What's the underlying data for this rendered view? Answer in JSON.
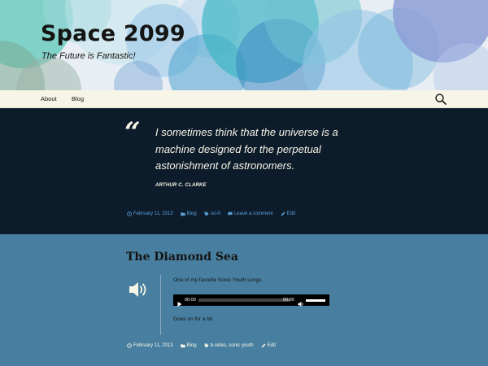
{
  "site": {
    "title": "Space 2099",
    "description": "The Future is Fantastic!"
  },
  "nav": {
    "items": [
      "About",
      "Blog"
    ],
    "search_icon": "search-icon"
  },
  "quote_post": {
    "quote": "I sometimes think that the universe is a machine designed for the perpetual astonishment of astronomers.",
    "attribution": "ARTHUR C. CLARKE",
    "meta": {
      "date": "February 11, 2013",
      "category": "Blog",
      "tag": "sci-fi",
      "comment": "Leave a comment",
      "edit": "Edit"
    }
  },
  "audio_post": {
    "title": "The Diamond Sea",
    "text_before": "One of my favorite Sonic Youth songs.",
    "player": {
      "current_time": "00:00",
      "duration": "00:00",
      "volume": 0.8
    },
    "text_after": "Goes on for a bit.",
    "meta": {
      "date": "February 11, 2013",
      "category": "Blog",
      "tags": "b-sides, sonic youth",
      "edit": "Edit"
    }
  },
  "colors": {
    "quote_bg": "#0d1c2b",
    "audio_bg": "#487fa0",
    "link": "#5aa1d8",
    "nav_bg": "#f7f5e7"
  }
}
